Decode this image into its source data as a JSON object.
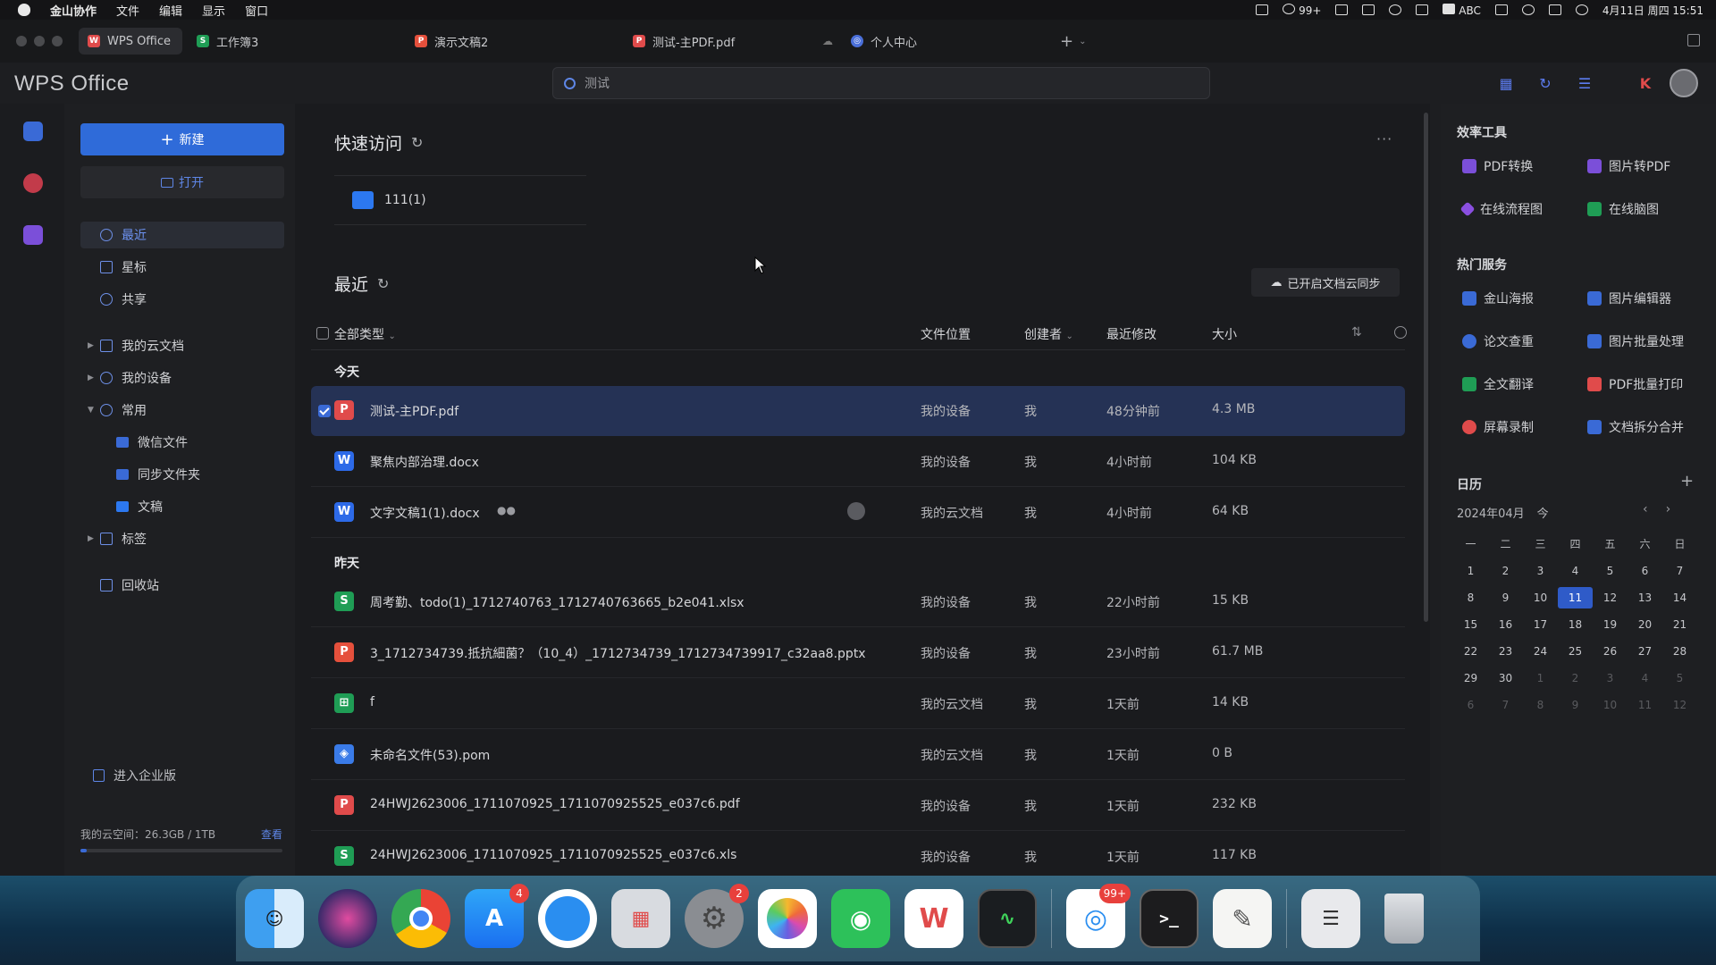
{
  "menubar": {
    "app": "金山协作",
    "items": [
      "文件",
      "编辑",
      "显示",
      "窗口"
    ],
    "qq_count": "99+",
    "input_method": "ABC",
    "datetime": "4月11日 周四 15:51"
  },
  "tabs": [
    {
      "label": "WPS Office",
      "icon": "W",
      "color": "#e04b4b"
    },
    {
      "label": "工作簿3",
      "icon": "S",
      "color": "#1f9d55"
    },
    {
      "label": "演示文稿2",
      "icon": "P",
      "color": "#e5503c"
    },
    {
      "label": "测试-主PDF.pdf",
      "icon": "P",
      "color": "#e04b4b"
    },
    {
      "label": "个人中心",
      "icon": "◎",
      "color": "#4a6fd9"
    }
  ],
  "tab_add": "+",
  "logo": "WPS Office",
  "search": {
    "value": "测试"
  },
  "sidebar": {
    "new_label": "新建",
    "open_label": "打开",
    "nav": [
      {
        "label": "最近"
      },
      {
        "label": "星标"
      },
      {
        "label": "共享"
      },
      {
        "label": "我的云文档"
      },
      {
        "label": "我的设备"
      },
      {
        "label": "常用"
      },
      {
        "label": "微信文件"
      },
      {
        "label": "同步文件夹"
      },
      {
        "label": "文稿"
      },
      {
        "label": "标签"
      },
      {
        "label": "回收站"
      }
    ],
    "enterprise": "进入企业版",
    "storage_label": "我的云空间：26.3GB / 1TB",
    "storage_view": "查看",
    "storage_fraction": 0.026
  },
  "quick_access": {
    "title": "快速访问",
    "more": "···",
    "folder": "111(1)"
  },
  "recent": {
    "title": "最近",
    "sync_label": "已开启文档云同步",
    "headers": {
      "type": "全部类型",
      "location": "文件位置",
      "creator": "创建者",
      "modified": "最近修改",
      "size": "大小"
    },
    "groups": [
      "今天",
      "昨天"
    ],
    "files": [
      {
        "name": "测试-主PDF.pdf",
        "icon": "P",
        "loc": "我的设备",
        "by": "我",
        "mod": "48分钟前",
        "size": "4.3 MB"
      },
      {
        "name": "聚焦内部治理.docx",
        "icon": "W",
        "loc": "我的设备",
        "by": "我",
        "mod": "4小时前",
        "size": "104 KB"
      },
      {
        "name": "文字文稿1(1).docx",
        "icon": "W",
        "loc": "我的云文档",
        "by": "我",
        "mod": "4小时前",
        "size": "64 KB"
      },
      {
        "name": "周考勤、todo(1)_1712740763_1712740763665_b2e041.xlsx",
        "icon": "S",
        "loc": "我的设备",
        "by": "我",
        "mod": "22小时前",
        "size": "15 KB"
      },
      {
        "name": "3_1712734739.抵抗細菌？（10_4）_1712734739_1712734739917_c32aa8.pptx",
        "icon": "P",
        "loc": "我的设备",
        "by": "我",
        "mod": "23小时前",
        "size": "61.7 MB"
      },
      {
        "name": "f",
        "icon": "⊞",
        "loc": "我的云文档",
        "by": "我",
        "mod": "1天前",
        "size": "14 KB"
      },
      {
        "name": "未命名文件(53).pom",
        "icon": "◈",
        "loc": "我的云文档",
        "by": "我",
        "mod": "1天前",
        "size": "0 B"
      },
      {
        "name": "24HWJ2623006_1711070925_1711070925525_e037c6.pdf",
        "icon": "P",
        "loc": "我的设备",
        "by": "我",
        "mod": "1天前",
        "size": "232 KB"
      },
      {
        "name": "24HWJ2623006_1711070925_1711070925525_e037c6.xls",
        "icon": "S",
        "loc": "我的设备",
        "by": "我",
        "mod": "1天前",
        "size": "117 KB"
      }
    ]
  },
  "right_panel": {
    "tools_title": "效率工具",
    "tools": [
      "PDF转换",
      "图片转PDF",
      "在线流程图",
      "在线脑图"
    ],
    "services_title": "热门服务",
    "services": [
      "金山海报",
      "图片编辑器",
      "论文查重",
      "图片批量处理",
      "全文翻译",
      "PDF批量打印",
      "屏幕录制",
      "文档拆分合并"
    ],
    "calendar_title": "日历",
    "calendar_add": "+",
    "month": "2024年04月",
    "today_label": "今",
    "weekdays": [
      "一",
      "二",
      "三",
      "四",
      "五",
      "六",
      "日"
    ],
    "weeks": [
      [
        "1",
        "2",
        "3",
        "4",
        "5",
        "6",
        "7"
      ],
      [
        "8",
        "9",
        "10",
        "11",
        "12",
        "13",
        "14"
      ],
      [
        "15",
        "16",
        "17",
        "18",
        "19",
        "20",
        "21"
      ],
      [
        "22",
        "23",
        "24",
        "25",
        "26",
        "27",
        "28"
      ],
      [
        "29",
        "30",
        "1",
        "2",
        "3",
        "4",
        "5"
      ],
      [
        "6",
        "7",
        "8",
        "9",
        "10",
        "11",
        "12"
      ]
    ],
    "today": "11"
  },
  "dock": {
    "apps": [
      {
        "name": "finder",
        "badge": ""
      },
      {
        "name": "siri",
        "badge": ""
      },
      {
        "name": "chrome",
        "badge": ""
      },
      {
        "name": "app-store",
        "badge": "4"
      },
      {
        "name": "safari",
        "badge": ""
      },
      {
        "name": "launchpad",
        "badge": ""
      },
      {
        "name": "system-settings",
        "badge": "2"
      },
      {
        "name": "photos",
        "badge": ""
      },
      {
        "name": "wechat",
        "badge": ""
      },
      {
        "name": "wps",
        "badge": ""
      },
      {
        "name": "activity-monitor",
        "badge": ""
      },
      {
        "name": "qq",
        "badge": "99+"
      },
      {
        "name": "terminal",
        "badge": ""
      },
      {
        "name": "textedit",
        "badge": ""
      },
      {
        "name": "finder-window",
        "badge": ""
      },
      {
        "name": "trash",
        "badge": ""
      }
    ]
  }
}
